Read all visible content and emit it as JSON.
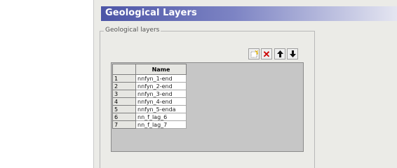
{
  "window": {
    "title": "Geological Layers"
  },
  "group": {
    "legend": "Geological layers"
  },
  "toolbar": {
    "buttons": [
      {
        "name": "new-row-icon",
        "glyph": "⬚"
      },
      {
        "name": "delete-icon",
        "glyph": "✕"
      },
      {
        "name": "arrow-up-icon",
        "glyph": "🡅"
      },
      {
        "name": "arrow-down-icon",
        "glyph": "🡇"
      }
    ]
  },
  "grid": {
    "column_header": "Name",
    "rows": [
      {
        "index": "1",
        "name": "nnfyn_1-end"
      },
      {
        "index": "2",
        "name": "nnfyn_2-end"
      },
      {
        "index": "3",
        "name": "nnfyn_3-end"
      },
      {
        "index": "4",
        "name": "nnfyn_4-end"
      },
      {
        "index": "5",
        "name": "nnfyn_5-enda"
      },
      {
        "index": "6",
        "name": "nn_f_lag_6"
      },
      {
        "index": "7",
        "name": "nn_f_lag_7"
      }
    ]
  }
}
